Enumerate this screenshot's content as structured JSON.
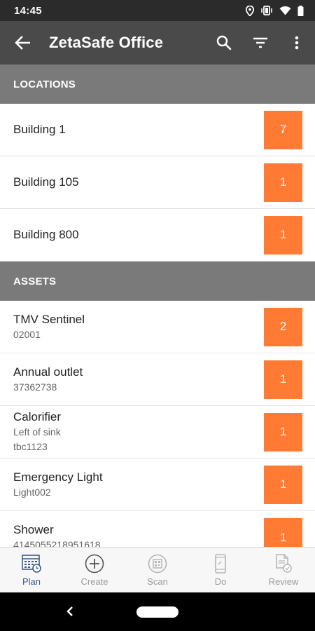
{
  "status_bar": {
    "time": "14:45"
  },
  "app_bar": {
    "title": "ZetaSafe Office"
  },
  "sections": {
    "locations": {
      "header": "LOCATIONS",
      "items": [
        {
          "title": "Building 1",
          "count": "7"
        },
        {
          "title": "Building 105",
          "count": "1"
        },
        {
          "title": "Building 800",
          "count": "1"
        }
      ]
    },
    "assets": {
      "header": "ASSETS",
      "items": [
        {
          "title": "TMV Sentinel",
          "line1": "02001",
          "line2": "",
          "count": "2"
        },
        {
          "title": "Annual outlet",
          "line1": "37362738",
          "line2": "",
          "count": "1"
        },
        {
          "title": "Calorifier",
          "line1": "Left of sink",
          "line2": "tbc1123",
          "count": "1"
        },
        {
          "title": "Emergency Light",
          "line1": "Light002",
          "line2": "",
          "count": "1"
        },
        {
          "title": "Shower",
          "line1": "4145055218951618",
          "line2": "",
          "count": "1"
        }
      ]
    }
  },
  "bottom_nav": {
    "items": [
      {
        "label": "Plan",
        "icon": "plan-icon",
        "active": true
      },
      {
        "label": "Create",
        "icon": "add-circle-icon",
        "active": false
      },
      {
        "label": "Scan",
        "icon": "scan-icon",
        "active": false
      },
      {
        "label": "Do",
        "icon": "phone-do-icon",
        "active": false
      },
      {
        "label": "Review",
        "icon": "review-icon",
        "active": false
      }
    ]
  },
  "colors": {
    "status_bar": "#2b2b2b",
    "app_bar": "#4a4a4a",
    "section_header": "#7a7a7a",
    "badge": "#ff7a33",
    "active_nav": "#3d5a87",
    "inactive_nav": "#9a9a9a"
  }
}
